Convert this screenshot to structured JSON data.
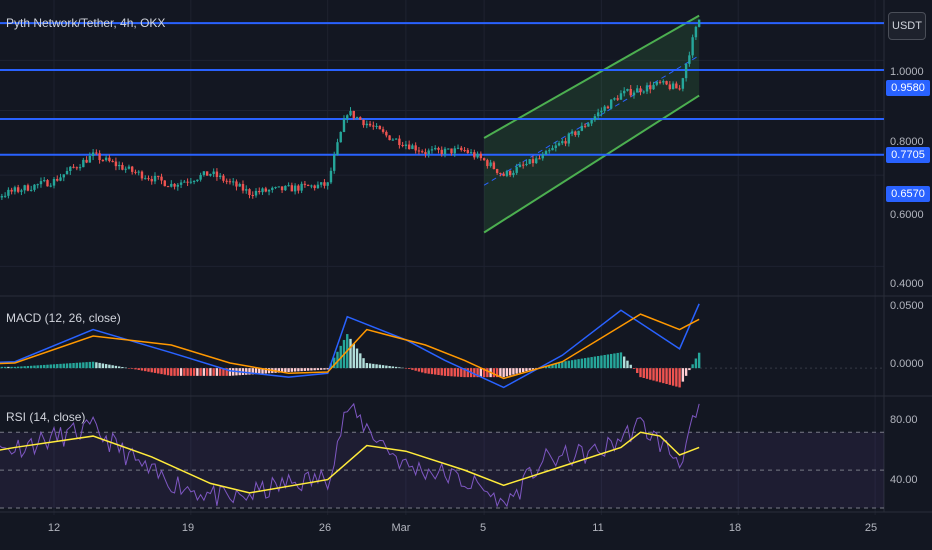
{
  "chart_data": [
    {
      "type": "candlestick",
      "title": "Pyth Network/Tether, 4h, OKX",
      "currency": "USDT",
      "y_scale": "log",
      "ylim": [
        0.36,
        1.24
      ],
      "x_ticks": [
        "12",
        "19",
        "26",
        "Mar",
        "5",
        "11",
        "18",
        "25"
      ],
      "y_ticks": [
        "1.0000",
        "0.8000",
        "0.6000",
        "0.4000"
      ],
      "horizontal_levels": [
        {
          "value": 1.18,
          "label": ""
        },
        {
          "value": 0.958,
          "label": "0.9580"
        },
        {
          "value": 0.7705,
          "label": "0.7705"
        },
        {
          "value": 0.657,
          "label": "0.6570"
        }
      ],
      "channel": {
        "upper": [
          {
            "x": "Mar 5",
            "y": 0.708
          },
          {
            "x": "Mar 16",
            "y": 1.22
          }
        ],
        "lower": [
          {
            "x": "Mar 5",
            "y": 0.465
          },
          {
            "x": "Mar 16",
            "y": 0.855
          }
        ],
        "color": "#4caf50"
      },
      "close_path": [
        {
          "t": "Feb 6",
          "v": 0.52
        },
        {
          "t": "Feb 8",
          "v": 0.53
        },
        {
          "t": "Feb 10",
          "v": 0.56
        },
        {
          "t": "Feb 12",
          "v": 0.585
        },
        {
          "t": "Feb 14",
          "v": 0.655
        },
        {
          "t": "Feb 16",
          "v": 0.61
        },
        {
          "t": "Feb 18",
          "v": 0.575
        },
        {
          "t": "Feb 20",
          "v": 0.605
        },
        {
          "t": "Feb 22",
          "v": 0.555
        },
        {
          "t": "Feb 24",
          "v": 0.565
        },
        {
          "t": "Feb 26",
          "v": 0.575
        },
        {
          "t": "Feb 27",
          "v": 0.795
        },
        {
          "t": "Feb 29",
          "v": 0.715
        },
        {
          "t": "Mar 2",
          "v": 0.665
        },
        {
          "t": "Mar 4",
          "v": 0.67
        },
        {
          "t": "Mar 5",
          "v": 0.64
        },
        {
          "t": "Mar 6",
          "v": 0.6
        },
        {
          "t": "Mar 8",
          "v": 0.65
        },
        {
          "t": "Mar 10",
          "v": 0.74
        },
        {
          "t": "Mar 12",
          "v": 0.86
        },
        {
          "t": "Mar 14",
          "v": 0.9
        },
        {
          "t": "Mar 15",
          "v": 0.88
        },
        {
          "t": "Mar 16",
          "v": 1.2
        }
      ],
      "bullish_color": "#26a69a",
      "bearish_color": "#ef5350"
    },
    {
      "type": "line",
      "title": "MACD (12, 26, close)",
      "y_ticks": [
        "0.0500",
        "0.0000"
      ],
      "ylim": [
        -0.017,
        0.053
      ],
      "series": [
        {
          "key": "macd",
          "color": "#2962ff",
          "values": [
            {
              "t": "Feb 6",
              "v": 0.003
            },
            {
              "t": "Feb 10",
              "v": 0.005
            },
            {
              "t": "Feb 14",
              "v": 0.03
            },
            {
              "t": "Feb 18",
              "v": 0.012
            },
            {
              "t": "Feb 21",
              "v": -0.002
            },
            {
              "t": "Feb 24",
              "v": -0.007
            },
            {
              "t": "Feb 26",
              "v": -0.004
            },
            {
              "t": "Feb 27",
              "v": 0.04
            },
            {
              "t": "Mar 1",
              "v": 0.022
            },
            {
              "t": "Mar 3",
              "v": 0.006
            },
            {
              "t": "Mar 6",
              "v": -0.015
            },
            {
              "t": "Mar 9",
              "v": 0.01
            },
            {
              "t": "Mar 12",
              "v": 0.045
            },
            {
              "t": "Mar 15",
              "v": 0.015
            },
            {
              "t": "Mar 16",
              "v": 0.05
            }
          ]
        },
        {
          "key": "signal",
          "color": "#ff9800",
          "values": [
            {
              "t": "Feb 6",
              "v": 0.002
            },
            {
              "t": "Feb 10",
              "v": 0.004
            },
            {
              "t": "Feb 14",
              "v": 0.025
            },
            {
              "t": "Feb 18",
              "v": 0.018
            },
            {
              "t": "Feb 21",
              "v": 0.004
            },
            {
              "t": "Feb 24",
              "v": -0.004
            },
            {
              "t": "Feb 26",
              "v": -0.003
            },
            {
              "t": "Feb 28",
              "v": 0.03
            },
            {
              "t": "Mar 2",
              "v": 0.018
            },
            {
              "t": "Mar 4",
              "v": 0.006
            },
            {
              "t": "Mar 6",
              "v": -0.008
            },
            {
              "t": "Mar 9",
              "v": 0.005
            },
            {
              "t": "Mar 13",
              "v": 0.042
            },
            {
              "t": "Mar 15",
              "v": 0.03
            },
            {
              "t": "Mar 16",
              "v": 0.038
            }
          ]
        }
      ],
      "histogram_colors": {
        "up": "#26a69a",
        "up_light": "#b2dfdb",
        "down": "#ef5350",
        "down_light": "#ffcdd2"
      }
    },
    {
      "type": "line",
      "title": "RSI (14, close)",
      "y_ticks": [
        "80.00",
        "40.00"
      ],
      "ylim": [
        30,
        86
      ],
      "bands": {
        "upper": 70,
        "middle": 50,
        "lower": 30,
        "fill": "#7e57c2"
      },
      "series": [
        {
          "key": "rsi",
          "color": "#7e57c2",
          "values": [
            {
              "t": "Feb 6",
              "v": 55
            },
            {
              "t": "Feb 10",
              "v": 62
            },
            {
              "t": "Feb 14",
              "v": 72
            },
            {
              "t": "Feb 17",
              "v": 48
            },
            {
              "t": "Feb 19",
              "v": 40
            },
            {
              "t": "Feb 21",
              "v": 34
            },
            {
              "t": "Feb 24",
              "v": 43
            },
            {
              "t": "Feb 26",
              "v": 46
            },
            {
              "t": "Feb 27",
              "v": 83
            },
            {
              "t": "Mar 1",
              "v": 52
            },
            {
              "t": "Mar 3",
              "v": 48
            },
            {
              "t": "Mar 5",
              "v": 40
            },
            {
              "t": "Mar 6",
              "v": 30
            },
            {
              "t": "Mar 8",
              "v": 55
            },
            {
              "t": "Mar 11",
              "v": 60
            },
            {
              "t": "Mar 13",
              "v": 74
            },
            {
              "t": "Mar 15",
              "v": 55
            },
            {
              "t": "Mar 16",
              "v": 82
            }
          ]
        },
        {
          "key": "rsi_ma",
          "color": "#ffeb3b",
          "values": [
            {
              "t": "Feb 6",
              "v": 55
            },
            {
              "t": "Feb 10",
              "v": 62
            },
            {
              "t": "Feb 14",
              "v": 68
            },
            {
              "t": "Feb 17",
              "v": 57
            },
            {
              "t": "Feb 20",
              "v": 43
            },
            {
              "t": "Feb 22",
              "v": 38
            },
            {
              "t": "Feb 26",
              "v": 45
            },
            {
              "t": "Feb 28",
              "v": 63
            },
            {
              "t": "Mar 1",
              "v": 60
            },
            {
              "t": "Mar 4",
              "v": 50
            },
            {
              "t": "Mar 6",
              "v": 42
            },
            {
              "t": "Mar 9",
              "v": 52
            },
            {
              "t": "Mar 12",
              "v": 62
            },
            {
              "t": "Mar 13",
              "v": 70
            },
            {
              "t": "Mar 14",
              "v": 68
            },
            {
              "t": "Mar 15",
              "v": 58
            },
            {
              "t": "Mar 16",
              "v": 62
            }
          ]
        }
      ]
    }
  ]
}
